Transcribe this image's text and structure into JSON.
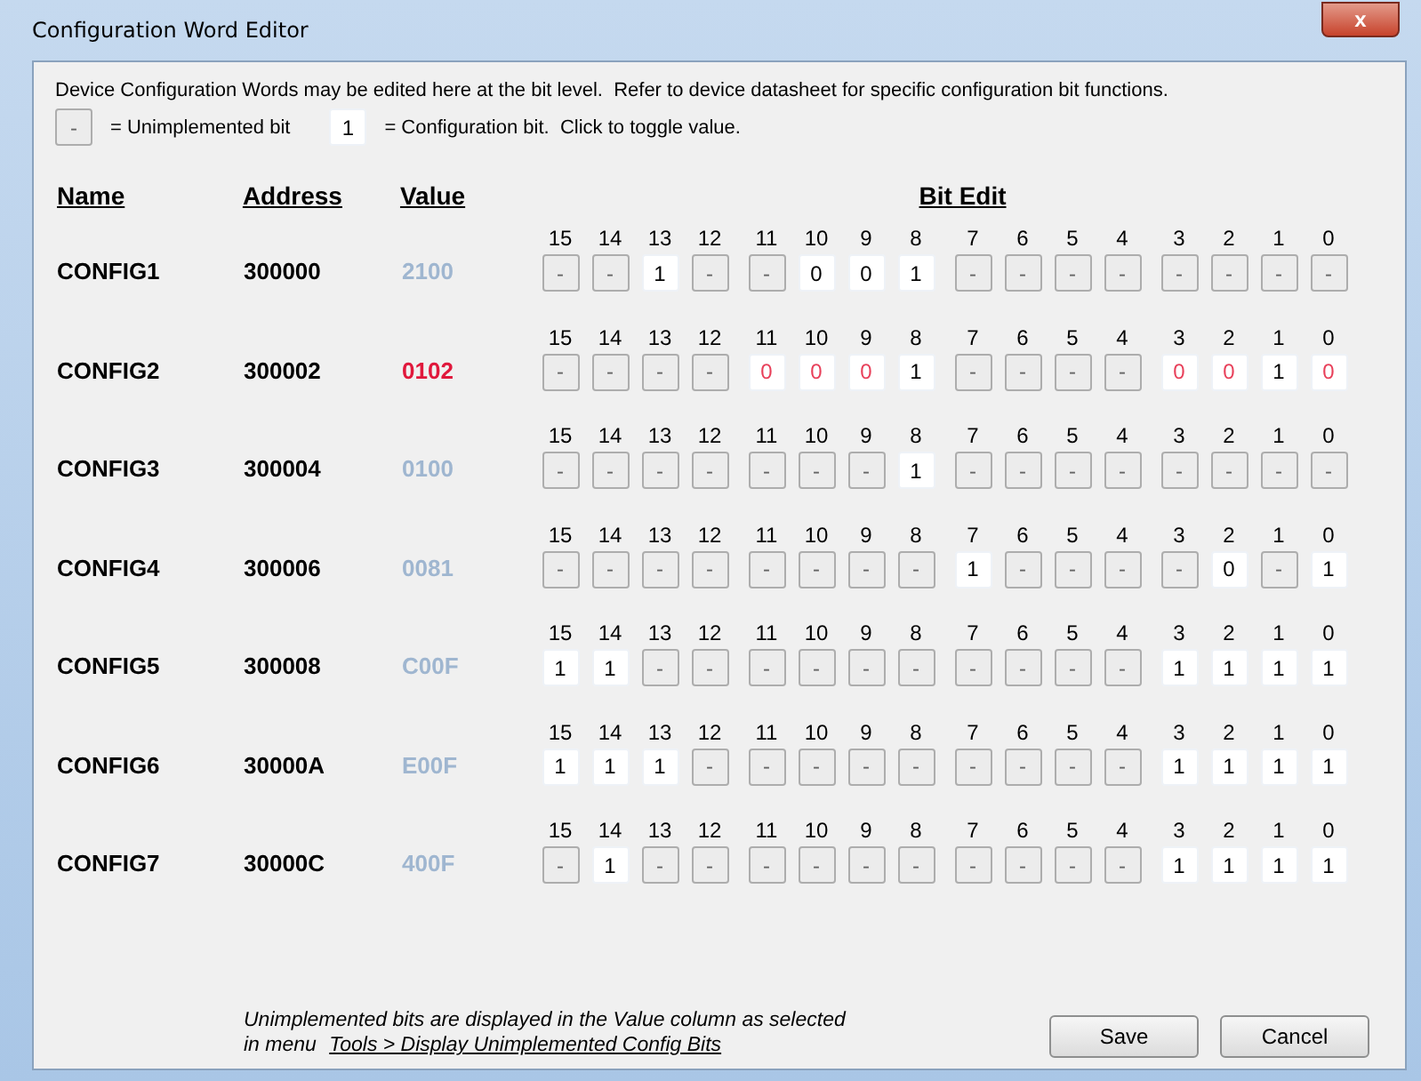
{
  "window": {
    "title": "Configuration Word Editor",
    "close": "x"
  },
  "intro": "Device Configuration Words may be edited here at the bit level.  Refer to device datasheet for specific configuration bit functions.",
  "legend": [
    {
      "kind": "unimplemented",
      "sample": "-",
      "text": "= Unimplemented bit"
    },
    {
      "kind": "implemented",
      "sample": "1",
      "text": "= Configuration bit.  Click to toggle value."
    }
  ],
  "columns": [
    "Name",
    "Address",
    "Value",
    "Bit Edit"
  ],
  "rows": [
    {
      "name": "CONFIG1",
      "address": "300000",
      "value": "2100",
      "modified": false,
      "bit_numbers": [
        "15",
        "14",
        "13",
        "12",
        "11",
        "10",
        "9",
        "8",
        "7",
        "6",
        "5",
        "4",
        "3",
        "2",
        "1",
        "0"
      ],
      "bits": [
        {
          "text": "-",
          "modified": false
        },
        {
          "text": "-",
          "modified": false
        },
        {
          "text": "1",
          "modified": false
        },
        {
          "text": "-",
          "modified": false
        },
        {
          "text": "-",
          "modified": false
        },
        {
          "text": "0",
          "modified": false
        },
        {
          "text": "0",
          "modified": false
        },
        {
          "text": "1",
          "modified": false
        },
        {
          "text": "-",
          "modified": false
        },
        {
          "text": "-",
          "modified": false
        },
        {
          "text": "-",
          "modified": false
        },
        {
          "text": "-",
          "modified": false
        },
        {
          "text": "-",
          "modified": false
        },
        {
          "text": "-",
          "modified": false
        },
        {
          "text": "-",
          "modified": false
        },
        {
          "text": "-",
          "modified": false
        }
      ]
    },
    {
      "name": "CONFIG2",
      "address": "300002",
      "value": "0102",
      "modified": true,
      "bit_numbers": [
        "15",
        "14",
        "13",
        "12",
        "11",
        "10",
        "9",
        "8",
        "7",
        "6",
        "5",
        "4",
        "3",
        "2",
        "1",
        "0"
      ],
      "bits": [
        {
          "text": "-",
          "modified": false
        },
        {
          "text": "-",
          "modified": false
        },
        {
          "text": "-",
          "modified": false
        },
        {
          "text": "-",
          "modified": false
        },
        {
          "text": "0",
          "modified": true
        },
        {
          "text": "0",
          "modified": true
        },
        {
          "text": "0",
          "modified": true
        },
        {
          "text": "1",
          "modified": false
        },
        {
          "text": "-",
          "modified": false
        },
        {
          "text": "-",
          "modified": false
        },
        {
          "text": "-",
          "modified": false
        },
        {
          "text": "-",
          "modified": false
        },
        {
          "text": "0",
          "modified": true
        },
        {
          "text": "0",
          "modified": true
        },
        {
          "text": "1",
          "modified": false
        },
        {
          "text": "0",
          "modified": true
        }
      ]
    },
    {
      "name": "CONFIG3",
      "address": "300004",
      "value": "0100",
      "modified": false,
      "bit_numbers": [
        "15",
        "14",
        "13",
        "12",
        "11",
        "10",
        "9",
        "8",
        "7",
        "6",
        "5",
        "4",
        "3",
        "2",
        "1",
        "0"
      ],
      "bits": [
        {
          "text": "-",
          "modified": false
        },
        {
          "text": "-",
          "modified": false
        },
        {
          "text": "-",
          "modified": false
        },
        {
          "text": "-",
          "modified": false
        },
        {
          "text": "-",
          "modified": false
        },
        {
          "text": "-",
          "modified": false
        },
        {
          "text": "-",
          "modified": false
        },
        {
          "text": "1",
          "modified": false
        },
        {
          "text": "-",
          "modified": false
        },
        {
          "text": "-",
          "modified": false
        },
        {
          "text": "-",
          "modified": false
        },
        {
          "text": "-",
          "modified": false
        },
        {
          "text": "-",
          "modified": false
        },
        {
          "text": "-",
          "modified": false
        },
        {
          "text": "-",
          "modified": false
        },
        {
          "text": "-",
          "modified": false
        }
      ]
    },
    {
      "name": "CONFIG4",
      "address": "300006",
      "value": "0081",
      "modified": false,
      "bit_numbers": [
        "15",
        "14",
        "13",
        "12",
        "11",
        "10",
        "9",
        "8",
        "7",
        "6",
        "5",
        "4",
        "3",
        "2",
        "1",
        "0"
      ],
      "bits": [
        {
          "text": "-",
          "modified": false
        },
        {
          "text": "-",
          "modified": false
        },
        {
          "text": "-",
          "modified": false
        },
        {
          "text": "-",
          "modified": false
        },
        {
          "text": "-",
          "modified": false
        },
        {
          "text": "-",
          "modified": false
        },
        {
          "text": "-",
          "modified": false
        },
        {
          "text": "-",
          "modified": false
        },
        {
          "text": "1",
          "modified": false
        },
        {
          "text": "-",
          "modified": false
        },
        {
          "text": "-",
          "modified": false
        },
        {
          "text": "-",
          "modified": false
        },
        {
          "text": "-",
          "modified": false
        },
        {
          "text": "0",
          "modified": false
        },
        {
          "text": "-",
          "modified": false
        },
        {
          "text": "1",
          "modified": false
        }
      ]
    },
    {
      "name": "CONFIG5",
      "address": "300008",
      "value": "C00F",
      "modified": false,
      "bit_numbers": [
        "15",
        "14",
        "13",
        "12",
        "11",
        "10",
        "9",
        "8",
        "7",
        "6",
        "5",
        "4",
        "3",
        "2",
        "1",
        "0"
      ],
      "bits": [
        {
          "text": "1",
          "modified": false
        },
        {
          "text": "1",
          "modified": false
        },
        {
          "text": "-",
          "modified": false
        },
        {
          "text": "-",
          "modified": false
        },
        {
          "text": "-",
          "modified": false
        },
        {
          "text": "-",
          "modified": false
        },
        {
          "text": "-",
          "modified": false
        },
        {
          "text": "-",
          "modified": false
        },
        {
          "text": "-",
          "modified": false
        },
        {
          "text": "-",
          "modified": false
        },
        {
          "text": "-",
          "modified": false
        },
        {
          "text": "-",
          "modified": false
        },
        {
          "text": "1",
          "modified": false
        },
        {
          "text": "1",
          "modified": false
        },
        {
          "text": "1",
          "modified": false
        },
        {
          "text": "1",
          "modified": false
        }
      ]
    },
    {
      "name": "CONFIG6",
      "address": "30000A",
      "value": "E00F",
      "modified": false,
      "bit_numbers": [
        "15",
        "14",
        "13",
        "12",
        "11",
        "10",
        "9",
        "8",
        "7",
        "6",
        "5",
        "4",
        "3",
        "2",
        "1",
        "0"
      ],
      "bits": [
        {
          "text": "1",
          "modified": false
        },
        {
          "text": "1",
          "modified": false
        },
        {
          "text": "1",
          "modified": false
        },
        {
          "text": "-",
          "modified": false
        },
        {
          "text": "-",
          "modified": false
        },
        {
          "text": "-",
          "modified": false
        },
        {
          "text": "-",
          "modified": false
        },
        {
          "text": "-",
          "modified": false
        },
        {
          "text": "-",
          "modified": false
        },
        {
          "text": "-",
          "modified": false
        },
        {
          "text": "-",
          "modified": false
        },
        {
          "text": "-",
          "modified": false
        },
        {
          "text": "1",
          "modified": false
        },
        {
          "text": "1",
          "modified": false
        },
        {
          "text": "1",
          "modified": false
        },
        {
          "text": "1",
          "modified": false
        }
      ]
    },
    {
      "name": "CONFIG7",
      "address": "30000C",
      "value": "400F",
      "modified": false,
      "bit_numbers": [
        "15",
        "14",
        "13",
        "12",
        "11",
        "10",
        "9",
        "8",
        "7",
        "6",
        "5",
        "4",
        "3",
        "2",
        "1",
        "0"
      ],
      "bits": [
        {
          "text": "-",
          "modified": false
        },
        {
          "text": "1",
          "modified": false
        },
        {
          "text": "-",
          "modified": false
        },
        {
          "text": "-",
          "modified": false
        },
        {
          "text": "-",
          "modified": false
        },
        {
          "text": "-",
          "modified": false
        },
        {
          "text": "-",
          "modified": false
        },
        {
          "text": "-",
          "modified": false
        },
        {
          "text": "-",
          "modified": false
        },
        {
          "text": "-",
          "modified": false
        },
        {
          "text": "-",
          "modified": false
        },
        {
          "text": "-",
          "modified": false
        },
        {
          "text": "1",
          "modified": false
        },
        {
          "text": "1",
          "modified": false
        },
        {
          "text": "1",
          "modified": false
        },
        {
          "text": "1",
          "modified": false
        }
      ]
    }
  ],
  "footnote": {
    "text": "Unimplemented bits are displayed in the Value column as selected",
    "prefix": "in menu",
    "link": "Tools > Display Unimplemented Config Bits"
  },
  "buttons": [
    "Save",
    "Cancel"
  ]
}
